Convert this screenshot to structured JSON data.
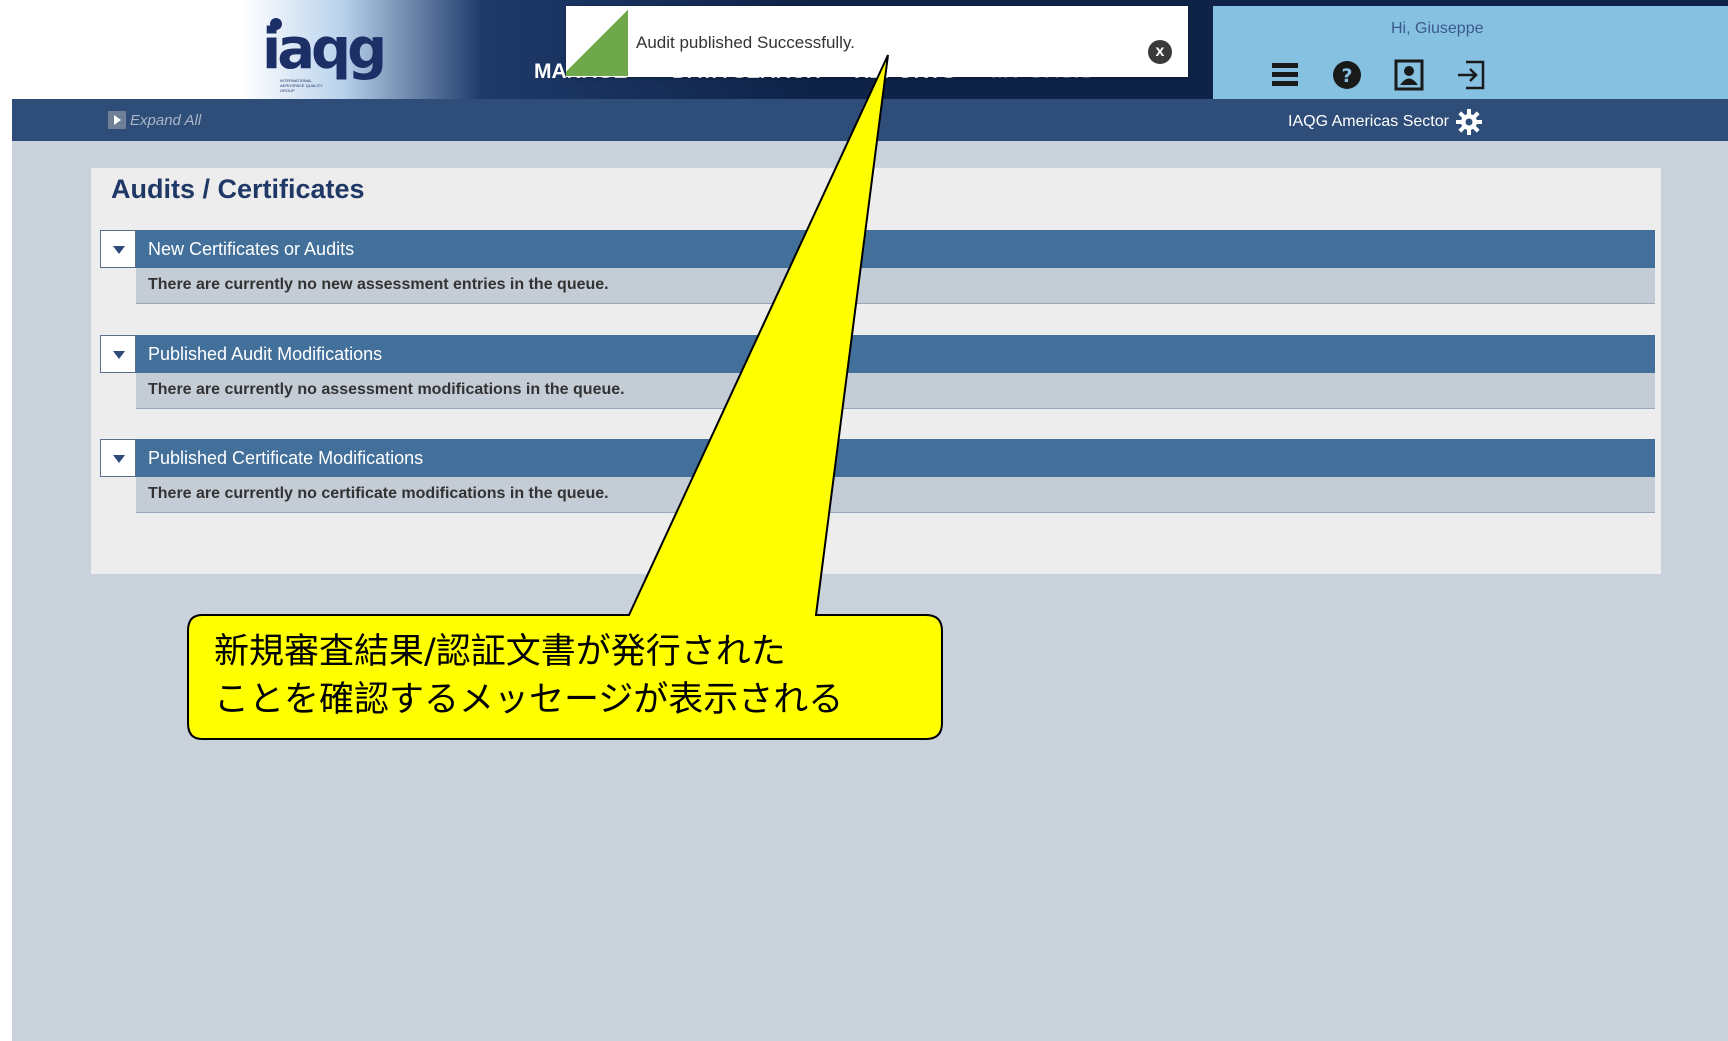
{
  "header": {
    "logo": {
      "text": "iaqg",
      "subtext": "INTERNATIONAL AEROSPACE QUALITY GROUP"
    },
    "nav": [
      "MANAGE",
      "DATA SEARCH",
      "REPORTS",
      "MY OASIS"
    ],
    "greeting": "Hi, Giuseppe",
    "icons": [
      "menu-icon",
      "help-icon",
      "profile-icon",
      "logout-icon"
    ]
  },
  "subbar": {
    "expand_all": "Expand All",
    "sector": "IAQG Americas Sector"
  },
  "toast": {
    "message": "Audit published Successfully.",
    "close": "x",
    "accent_color": "#6ea84a"
  },
  "page": {
    "title": "Audits / Certificates",
    "sections": [
      {
        "title": "New Certificates or Audits",
        "body": "There are currently no new assessment entries in the queue."
      },
      {
        "title": "Published Audit Modifications",
        "body": "There are currently no assessment modifications in the queue."
      },
      {
        "title": "Published Certificate Modifications",
        "body": "There are currently no certificate modifications in the queue."
      }
    ]
  },
  "callout": {
    "text": "新規審査結果/認証文書が発行された\nことを確認するメッセージが表示される",
    "fill_color": "#ffff00"
  }
}
